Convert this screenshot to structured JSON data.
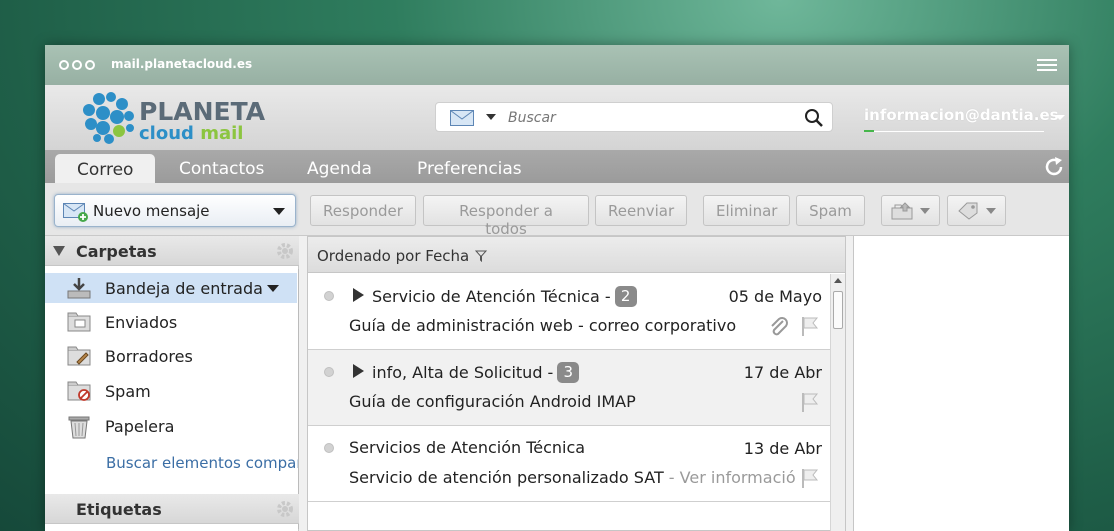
{
  "browser": {
    "url": "mail.planetacloud.es"
  },
  "brand": {
    "line1": "PLANETA",
    "line2_a": "cloud",
    "line2_b": "mail"
  },
  "search": {
    "placeholder": "Buscar"
  },
  "account": {
    "email": "informacion@dantia.es"
  },
  "tabs": [
    {
      "label": "Correo",
      "active": true
    },
    {
      "label": "Contactos"
    },
    {
      "label": "Agenda"
    },
    {
      "label": "Preferencias"
    }
  ],
  "toolbar": {
    "new_message": "Nuevo mensaje",
    "reply": "Responder",
    "reply_all": "Responder a todos",
    "forward": "Reenviar",
    "delete": "Eliminar",
    "spam": "Spam"
  },
  "sidebar": {
    "folders_header": "Carpetas",
    "folders": [
      {
        "label": "Bandeja de entrada",
        "icon": "inbox-download-icon",
        "selected": true
      },
      {
        "label": "Enviados",
        "icon": "sent-folder-icon"
      },
      {
        "label": "Borradores",
        "icon": "drafts-folder-icon"
      },
      {
        "label": "Spam",
        "icon": "spam-folder-icon"
      },
      {
        "label": "Papelera",
        "icon": "trash-icon"
      }
    ],
    "shared_link": "Buscar elementos compartidos",
    "tags_header": "Etiquetas"
  },
  "list": {
    "sort_label": "Ordenado por Fecha",
    "messages": [
      {
        "subject": "Servicio de Atención Técnica -",
        "count": "2",
        "date": "05 de Mayo",
        "preview": "Guía de administración web - correo corporativo",
        "preview_extra": "",
        "has_attachment": true,
        "threaded": true
      },
      {
        "subject": "info, Alta de Solicitud -",
        "count": "3",
        "date": "17 de Abr",
        "preview": "Guía de configuración Android IMAP",
        "preview_extra": "",
        "has_attachment": false,
        "threaded": true
      },
      {
        "subject": "Servicios de Atención Técnica",
        "count": "",
        "date": "13 de Abr",
        "preview": "Servicio de atención personalizado SAT",
        "preview_extra": " - Ver información anexa",
        "has_attachment": false,
        "threaded": false
      }
    ]
  },
  "colors": {
    "accent": "#2d8fc7",
    "brand_green": "#8cc540",
    "selection": "#cfe1f5"
  }
}
